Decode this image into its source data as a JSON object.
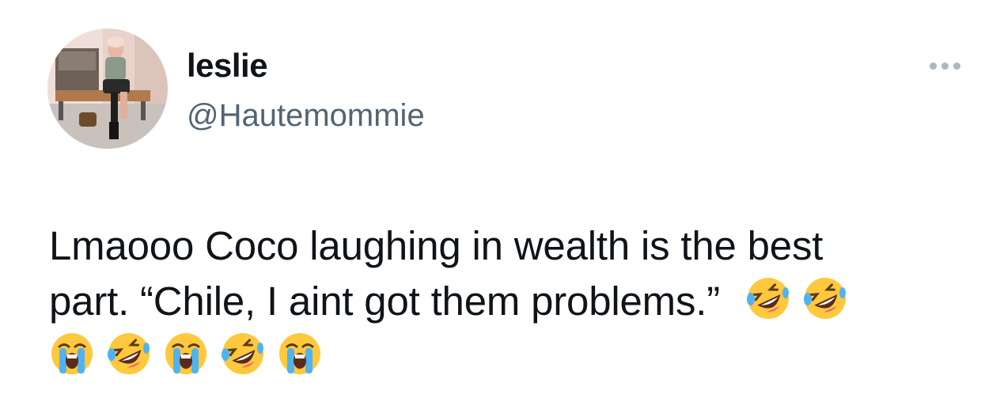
{
  "tweet": {
    "display_name": "leslie",
    "handle": "@Hautemommie",
    "text_line1": "Lmaooo Coco laughing in wealth is the best",
    "text_line2": "part. “Chile, I aint got them problems.”",
    "emojis_line2": [
      "rofl-emoji",
      "rofl-emoji"
    ],
    "emojis_line3": [
      "sob-emoji",
      "rofl-emoji",
      "sob-emoji",
      "rofl-emoji",
      "sob-emoji"
    ]
  },
  "more_menu_icon": "ellipsis-icon",
  "colors": {
    "text": "#0f1419",
    "handle": "#536471",
    "more_dots": "#aab8c2"
  }
}
